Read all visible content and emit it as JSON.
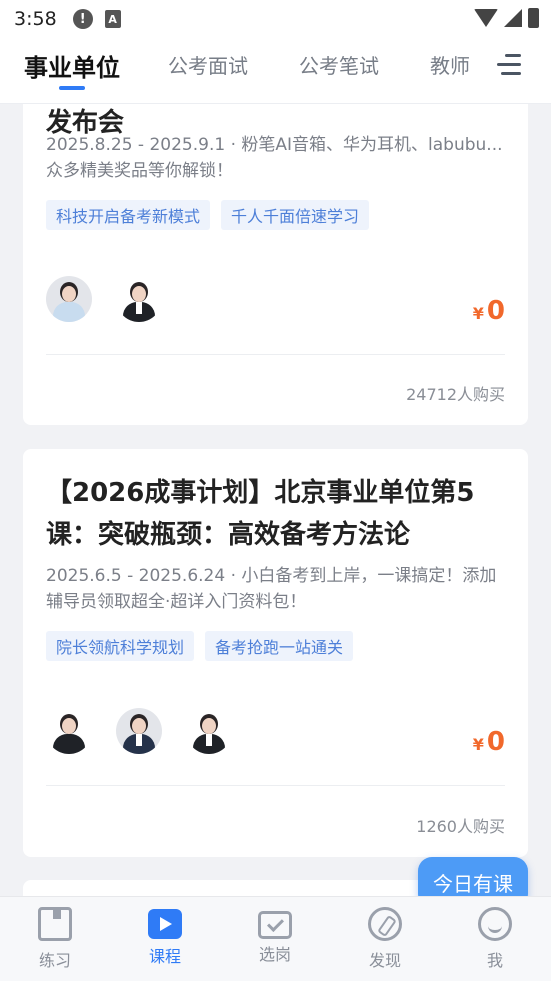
{
  "status_bar": {
    "time": "3:58",
    "icons": [
      "alert-icon",
      "a-icon",
      "wifi-icon",
      "signal-icon",
      "battery-icon"
    ]
  },
  "tabs": [
    {
      "label": "事业单位",
      "active": true
    },
    {
      "label": "公考面试",
      "active": false
    },
    {
      "label": "公考笔试",
      "active": false
    },
    {
      "label": "教师",
      "active": false
    }
  ],
  "courses": [
    {
      "title_fragment": "发布会",
      "description": "2025.8.25 - 2025.9.1 · 粉笔AI音箱、华为耳机、labubu...众多精美奖品等你解锁！",
      "tags": [
        "科技开启备考新模式",
        "千人千面倍速学习"
      ],
      "price_currency": "¥",
      "price": "0",
      "buyers": "24712人购买"
    },
    {
      "title": "【2026成事计划】北京事业单位第5课：突破瓶颈：高效备考方法论",
      "description": "2025.6.5 - 2025.6.24 · 小白备考到上岸，一课搞定！添加辅导员领取超全·超详入门资料包！",
      "tags": [
        "院长领航科学规划",
        "备考抢跑一站通关"
      ],
      "price_currency": "¥",
      "price": "0",
      "buyers": "1260人购买"
    }
  ],
  "floating_button": {
    "label": "今日有课"
  },
  "bottom_nav": [
    {
      "label": "练习",
      "icon": "book-icon",
      "active": false
    },
    {
      "label": "课程",
      "icon": "play-icon",
      "active": true
    },
    {
      "label": "选岗",
      "icon": "briefcase-check-icon",
      "active": false
    },
    {
      "label": "发现",
      "icon": "compass-icon",
      "active": false
    },
    {
      "label": "我",
      "icon": "smile-icon",
      "active": false
    }
  ],
  "colors": {
    "accent": "#2f7bf6",
    "price": "#f1682b",
    "tag_bg": "#eef3fc",
    "tag_text": "#4d7fd8"
  }
}
